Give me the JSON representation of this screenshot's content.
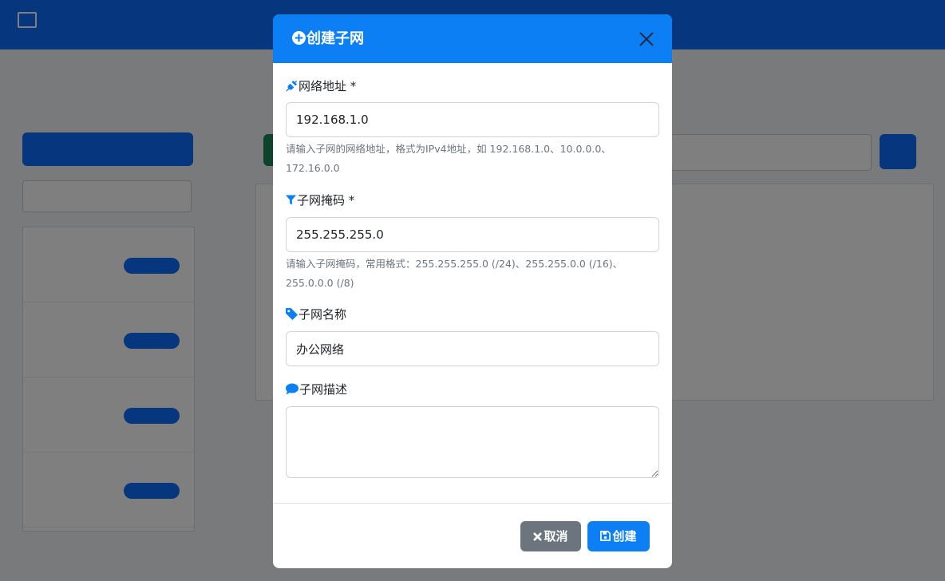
{
  "colors": {
    "primary": "#0d7ff4",
    "secondary": "#6c757d",
    "overlay": "rgba(0,0,0,0.5)"
  },
  "modal": {
    "title": "创建子网",
    "fields": {
      "network_address": {
        "label": "网络地址 *",
        "value": "192.168.1.0",
        "help": "请输入子网的网络地址，格式为IPv4地址，如 192.168.1.0、10.0.0.0、172.16.0.0",
        "icon": "plug-icon"
      },
      "subnet_mask": {
        "label": "子网掩码 *",
        "value": "255.255.255.0",
        "help": "请输入子网掩码，常用格式：255.255.255.0 (/24)、255.255.0.0 (/16)、255.0.0.0 (/8)",
        "icon": "filter-icon"
      },
      "subnet_name": {
        "label": "子网名称",
        "value": "办公网络",
        "icon": "tag-icon"
      },
      "subnet_description": {
        "label": "子网描述",
        "value": "",
        "icon": "comment-icon"
      }
    },
    "buttons": {
      "cancel": "取消",
      "create": "创建"
    }
  }
}
